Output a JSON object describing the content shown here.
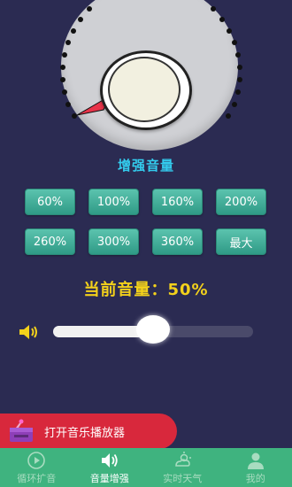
{
  "section_title": "增强音量",
  "boost_buttons": [
    "60%",
    "100%",
    "160%",
    "200%",
    "260%",
    "300%",
    "360%",
    "最大"
  ],
  "current_volume_label": "当前音量：",
  "current_volume_value": "50%",
  "volume_slider": {
    "value": 0.5
  },
  "player_button_label": "打开音乐播放器",
  "tabs": [
    {
      "label": "循环扩音",
      "icon": "play-circle-icon",
      "active": false
    },
    {
      "label": "音量增强",
      "icon": "speaker-icon",
      "active": true
    },
    {
      "label": "实时天气",
      "icon": "weather-icon",
      "active": false
    },
    {
      "label": "我的",
      "icon": "user-icon",
      "active": false
    }
  ],
  "colors": {
    "background": "#2b2b52",
    "accent_title": "#33ccee",
    "volume_text": "#f3d11b",
    "button": "#3aa890",
    "tabbar": "#3fb37f",
    "player": "#d8283c"
  }
}
